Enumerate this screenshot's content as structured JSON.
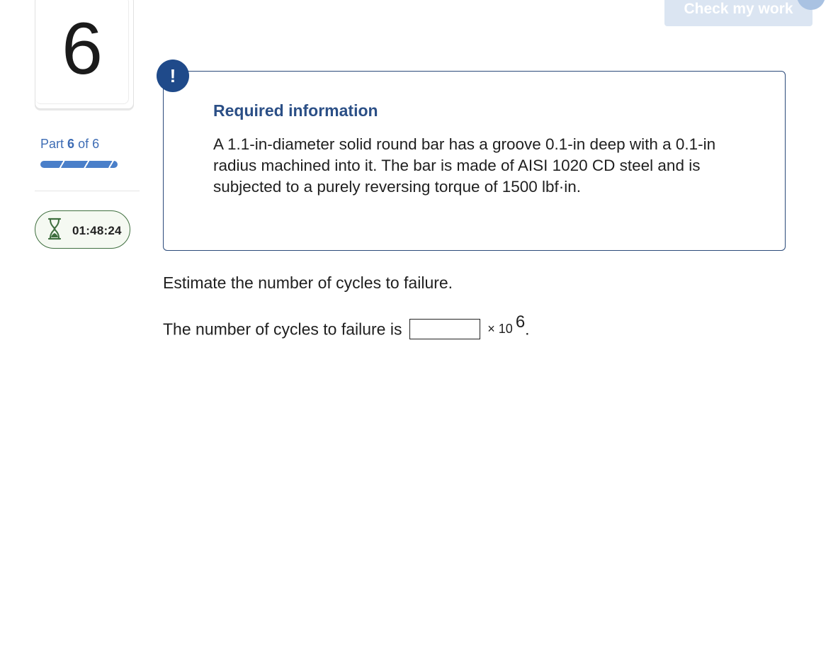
{
  "question_card": {
    "number": "6"
  },
  "part": {
    "prefix": "Part",
    "current": "6",
    "of_label": "of 6",
    "progress": 1.0
  },
  "timer": {
    "time": "01:48:24",
    "icon": "hourglass-icon"
  },
  "header": {
    "check_label": "Check my work"
  },
  "info": {
    "icon": "!",
    "title": "Required information",
    "body": "A 1.1-in-diameter solid round bar has a groove 0.1-in deep with a 0.1-in radius machined into it. The bar is made of AISI 1020 CD steel and is subjected to a purely reversing torque of 1500 lbf·in."
  },
  "question": {
    "prompt": "Estimate the number of cycles to failure.",
    "answer_prefix": "The number of cycles to failure is",
    "answer_value": "",
    "multiplier": "× 10",
    "exponent": "6",
    "suffix": "."
  },
  "colors": {
    "accent": "#2b4f86",
    "alert": "#1f4a8a",
    "timer_border": "#3f6f3f",
    "progress": "#4a7fc9"
  }
}
